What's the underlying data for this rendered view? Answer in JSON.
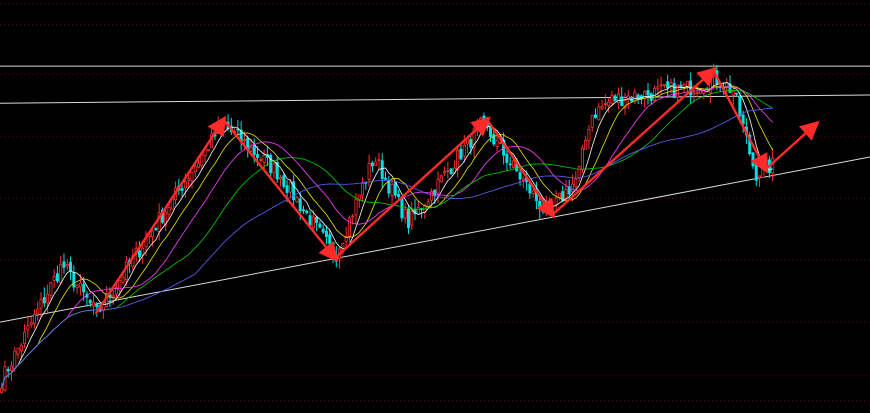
{
  "chart_data": {
    "type": "candlestick",
    "title": "",
    "xlabel": "",
    "ylabel": "",
    "x_range": [
      0,
      100
    ],
    "y_range": [
      0,
      100
    ],
    "grid": true,
    "gridline_values": [
      3,
      9,
      22,
      37,
      52,
      67,
      82,
      94,
      99
    ],
    "colors": {
      "background": "#000000",
      "grid": "#6e0000",
      "up_candle": "#ff3030",
      "down_candle": "#00e0e0",
      "trend_arrow": "#ff2a2a",
      "reference_line": "#d8d8d8"
    },
    "price_path": [
      {
        "x": 0,
        "y": 8
      },
      {
        "x": 7,
        "y": 36
      },
      {
        "x": 11,
        "y": 24
      },
      {
        "x": 25.5,
        "y": 70
      },
      {
        "x": 32,
        "y": 58
      },
      {
        "x": 38.5,
        "y": 38
      },
      {
        "x": 43,
        "y": 62
      },
      {
        "x": 47,
        "y": 46
      },
      {
        "x": 55.5,
        "y": 70
      },
      {
        "x": 63,
        "y": 48
      },
      {
        "x": 66.5,
        "y": 57
      },
      {
        "x": 68,
        "y": 72
      },
      {
        "x": 70.5,
        "y": 76
      },
      {
        "x": 80,
        "y": 79
      },
      {
        "x": 82.5,
        "y": 81
      },
      {
        "x": 84.5,
        "y": 78
      },
      {
        "x": 87,
        "y": 58
      },
      {
        "x": 89,
        "y": 60
      }
    ],
    "moving_averages": [
      {
        "color": "#ffffff",
        "lag": 2
      },
      {
        "color": "#e8e800",
        "lag": 4
      },
      {
        "color": "#ff40ff",
        "lag": 7
      },
      {
        "color": "#00d000",
        "lag": 12
      },
      {
        "color": "#6060ff",
        "lag": 20
      }
    ],
    "trend_arrows": [
      {
        "x1": 11,
        "y1": 24,
        "x2": 25.7,
        "y2": 71
      },
      {
        "x1": 25.7,
        "y1": 71,
        "x2": 38.5,
        "y2": 37.5
      },
      {
        "x1": 38.5,
        "y1": 37.5,
        "x2": 56,
        "y2": 71
      },
      {
        "x1": 56,
        "y1": 71,
        "x2": 63.5,
        "y2": 48
      },
      {
        "x1": 63.5,
        "y1": 48,
        "x2": 82,
        "y2": 83
      },
      {
        "x1": 82,
        "y1": 83,
        "x2": 88,
        "y2": 59
      },
      {
        "x1": 88,
        "y1": 59,
        "x2": 93.8,
        "y2": 70
      }
    ],
    "reference_lines": [
      {
        "x1": 0,
        "y1": 84,
        "x2": 100,
        "y2": 84
      },
      {
        "x1": 0,
        "y1": 75,
        "x2": 100,
        "y2": 77
      },
      {
        "x1": 0,
        "y1": 22,
        "x2": 100,
        "y2": 62
      }
    ]
  }
}
